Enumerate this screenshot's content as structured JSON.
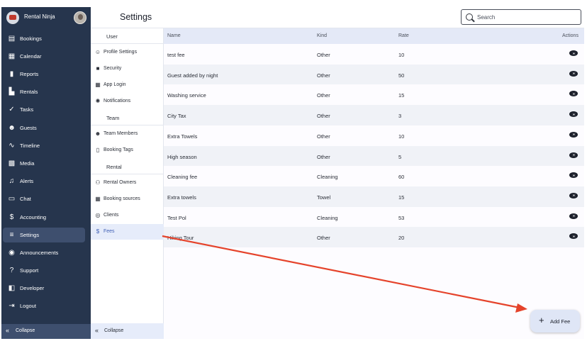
{
  "app": {
    "brand_name": "Rental Ninja"
  },
  "sidebar": {
    "items": [
      {
        "label": "Bookings",
        "icon": "bookings-icon",
        "glyph": "▤"
      },
      {
        "label": "Calendar",
        "icon": "calendar-icon",
        "glyph": "▦"
      },
      {
        "label": "Reports",
        "icon": "reports-icon",
        "glyph": "▮"
      },
      {
        "label": "Rentals",
        "icon": "rentals-icon",
        "glyph": "▙"
      },
      {
        "label": "Tasks",
        "icon": "tasks-icon",
        "glyph": "✓"
      },
      {
        "label": "Guests",
        "icon": "guests-icon",
        "glyph": "☻"
      },
      {
        "label": "Timeline",
        "icon": "timeline-icon",
        "glyph": "∿"
      },
      {
        "label": "Media",
        "icon": "media-icon",
        "glyph": "▩"
      },
      {
        "label": "Alerts",
        "icon": "alerts-icon",
        "glyph": "♫"
      },
      {
        "label": "Chat",
        "icon": "chat-icon",
        "glyph": "▭"
      },
      {
        "label": "Accounting",
        "icon": "accounting-icon",
        "glyph": "$"
      },
      {
        "label": "Settings",
        "icon": "settings-icon",
        "glyph": "≡"
      },
      {
        "label": "Announcements",
        "icon": "announcements-icon",
        "glyph": "◉"
      },
      {
        "label": "Support",
        "icon": "support-icon",
        "glyph": "?"
      },
      {
        "label": "Developer",
        "icon": "developer-icon",
        "glyph": "◧"
      },
      {
        "label": "Logout",
        "icon": "logout-icon",
        "glyph": "⇥"
      }
    ],
    "active": "Settings",
    "collapse_label": "Collapse"
  },
  "header": {
    "title": "Settings",
    "search_placeholder": "Search"
  },
  "submenu": {
    "sections": {
      "user": "User",
      "team": "Team",
      "rental": "Rental"
    },
    "items": [
      {
        "label": "Profile Settings",
        "icon": "profile-settings-icon",
        "glyph": "☺"
      },
      {
        "label": "Security",
        "icon": "lock-icon",
        "glyph": "■"
      },
      {
        "label": "App Login",
        "icon": "qr-code-icon",
        "glyph": "▦"
      },
      {
        "label": "Notifications",
        "icon": "notifications-icon",
        "glyph": "✺"
      },
      {
        "label": "Team Members",
        "icon": "team-members-icon",
        "glyph": "☻"
      },
      {
        "label": "Booking Tags",
        "icon": "booking-tags-icon",
        "glyph": "▯"
      },
      {
        "label": "Rental Owners",
        "icon": "rental-owners-icon",
        "glyph": "⚇"
      },
      {
        "label": "Booking sources",
        "icon": "booking-sources-icon",
        "glyph": "▦"
      },
      {
        "label": "Clients",
        "icon": "clients-icon",
        "glyph": "◎"
      },
      {
        "label": "Fees",
        "icon": "dollar-icon",
        "glyph": "$"
      }
    ],
    "active": "Fees",
    "collapse_label": "Collapse"
  },
  "table": {
    "columns": [
      "Name",
      "Kind",
      "Rate",
      "Actions"
    ],
    "rows": [
      {
        "name": "test fee",
        "kind": "Other",
        "rate": "10"
      },
      {
        "name": "Guest added by night",
        "kind": "Other",
        "rate": "50"
      },
      {
        "name": "Washing service",
        "kind": "Other",
        "rate": "15"
      },
      {
        "name": "City Tax",
        "kind": "Other",
        "rate": "3"
      },
      {
        "name": "Extra Towels",
        "kind": "Other",
        "rate": "10"
      },
      {
        "name": "High season",
        "kind": "Other",
        "rate": "5"
      },
      {
        "name": "Cleaning fee",
        "kind": "Cleaning",
        "rate": "60"
      },
      {
        "name": "Extra towels",
        "kind": "Towel",
        "rate": "15"
      },
      {
        "name": "Test Pol",
        "kind": "Cleaning",
        "rate": "53"
      },
      {
        "name": "Hiking Tour",
        "kind": "Other",
        "rate": "20"
      }
    ]
  },
  "add_fee_button": {
    "label": "Add Fee"
  },
  "colors": {
    "sidebar_bg": "#26354d",
    "accent": "#3f5fb5",
    "annotation_arrow": "#e5432b"
  }
}
